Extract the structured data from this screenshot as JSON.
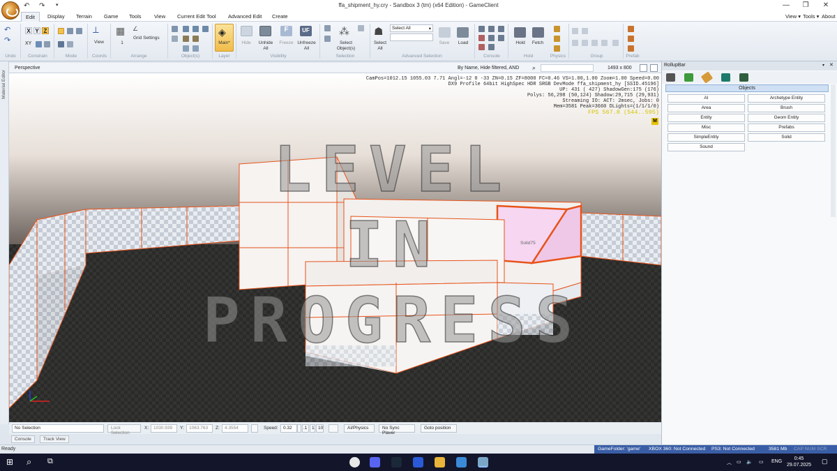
{
  "window": {
    "title": "ffa_shipment_hy.cry - Sandbox 3 (tm) (x64 Edition) - GameClient",
    "minimize": "—",
    "maximize": "❐",
    "close": "✕",
    "right_menu": [
      "View ▾",
      "Tools ▾",
      "About"
    ]
  },
  "quick_access": {
    "undo": "↶",
    "redo": "↷"
  },
  "menu": {
    "tabs": [
      "Edit",
      "Display",
      "Terrain",
      "Game",
      "Tools",
      "View",
      "Current Edit Tool",
      "Advanced Edit",
      "Create"
    ],
    "active": "Edit"
  },
  "ribbon": {
    "groups": [
      "Undo",
      "Constrain",
      "Mode",
      "Coords",
      "Arrange",
      "Object(s)",
      "Layer",
      "Visibility",
      "Selection",
      "Advanced Selection",
      "Console",
      "Physics",
      "Hold",
      "Group",
      "Prefab"
    ],
    "constrain_buttons": [
      "X",
      "Y",
      "Z",
      "XY"
    ],
    "coords_view": "View",
    "arrange_value": "1",
    "grid_settings": "Grid Settings",
    "layer_label": "Main*",
    "visibility_buttons": [
      "Hide",
      "Unhide All",
      "Freeze",
      "Unfreeze All"
    ],
    "freeze_icon": "F",
    "unfreeze_icon": "UF",
    "selection_buttons": [
      "Select Object(s)"
    ],
    "adv_select_button": "Select All",
    "adv_select_value": "Select All",
    "adv_select_buttons": [
      "Save",
      "Load"
    ],
    "hold_buttons": [
      "Hold",
      "Fetch"
    ]
  },
  "viewport": {
    "name": "Perspective",
    "filter": "By Name, Hide filtered, AND",
    "resolution": "1493 x 800",
    "stats": [
      "CamPos=1012.15 1055.03 7.71 Angl=-12  0 -33 ZN=0.15 ZF=8000 FC=0.46 VS=1.00,1.00 Zoom=1.00 Speed=0.00",
      "DX9 Profile 64bit HighSpec HDR SRGB DevMode ffa_shipment_hy [SSID.45196]",
      "UP: 431 ( 427) ShadowGen:175 (176)",
      "Polys: 56,298 (50,124) Shadow:29,715 (29,931)",
      "Streaming IO: ACT:   2msec, Jobs: 0",
      "Mem=3581 Peak=3660 DLights=(1/1/1/0)"
    ],
    "fps": "FPS 567.8 (544..595)",
    "badge": "M",
    "watermark": [
      "LEVEL",
      "IN",
      "PROGRESS"
    ],
    "solid_label": "Solid75"
  },
  "left_panel": {
    "label": "Material Editor"
  },
  "bottom_bar": {
    "selection": "No Selection",
    "lock": "Lock Selection",
    "x_label": "X:",
    "x": "1030.939",
    "y_label": "Y:",
    "y": "1063.763",
    "z_label": "Z:",
    "z": "4.3554",
    "speed_label": "Speed:",
    "speed": "0.32",
    "speed_presets": [
      ".1",
      "1",
      "10"
    ],
    "buttons": [
      "AI/Physics",
      "No Sync Player",
      "Goto position"
    ]
  },
  "bottom_tabs": [
    "Console",
    "Track View"
  ],
  "status": {
    "ready": "Ready",
    "game_folder": "GameFolder: 'game'",
    "xbox": "XBOX 360: Not Connected",
    "ps3": "PS3: Not Connected",
    "mem": "3581 Mb",
    "keys": "CAP  NUM  SCR"
  },
  "rollup": {
    "title": "RollupBar",
    "pin": "📌",
    "close": "✕",
    "section": "Objects",
    "buttons": [
      "AI",
      "Archetype Entity",
      "Area",
      "Brush",
      "Entity",
      "Geom Entity",
      "Misc",
      "Prefabs",
      "SimpleEntity",
      "Solid",
      "Sound"
    ]
  },
  "taskbar": {
    "time": "0:45",
    "date": "29.07.2025",
    "lang": "ENG"
  },
  "colors": {
    "accent": "#3a5ea6",
    "selection_orange": "#e8531a",
    "fps_yellow": "#d4c400"
  }
}
